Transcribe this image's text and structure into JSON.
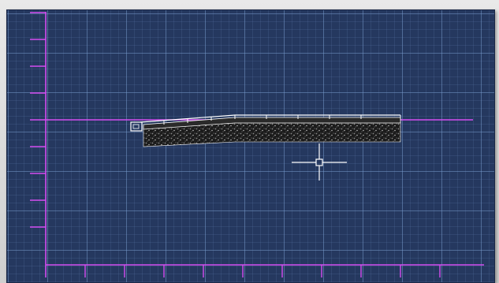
{
  "app": {
    "viewport_label": ""
  },
  "colors": {
    "background": "#25385f",
    "grid_major": "#7da0d2",
    "grid_minor": "#5f7daf",
    "axis": "#d44df0",
    "sketch_outline": "#ffffff",
    "sketch_fill": "#1b1b1b",
    "cursor": "#ffffff"
  },
  "icons": {
    "cursor": "crosshair-cursor-icon",
    "pickbox": "pickbox-icon"
  }
}
